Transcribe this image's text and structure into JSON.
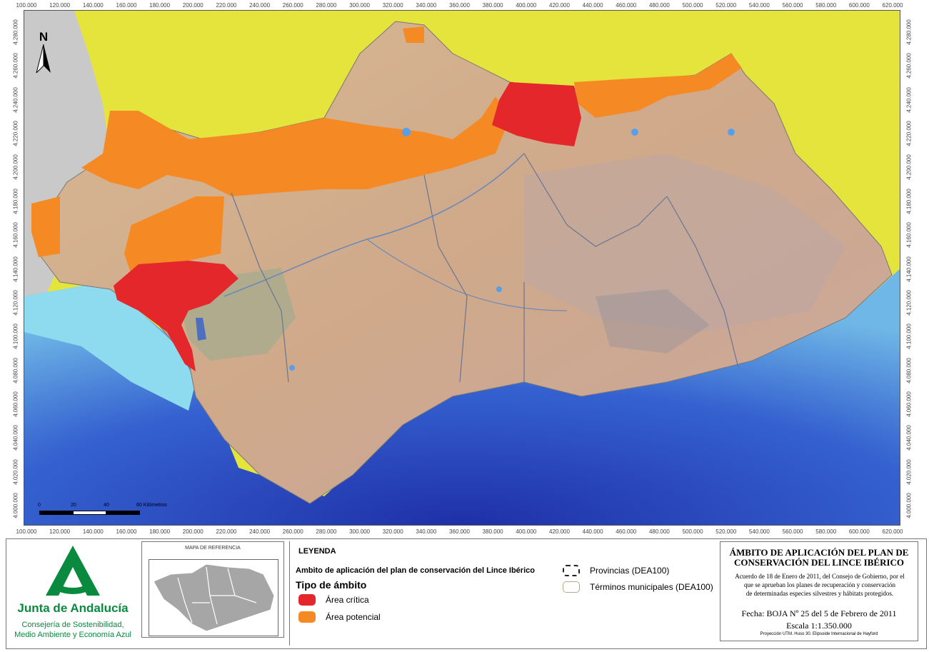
{
  "map": {
    "x_ticks": [
      "100.000",
      "120.000",
      "140.000",
      "160.000",
      "180.000",
      "200.000",
      "220.000",
      "240.000",
      "260.000",
      "280.000",
      "300.000",
      "320.000",
      "340.000",
      "360.000",
      "380.000",
      "400.000",
      "420.000",
      "440.000",
      "460.000",
      "480.000",
      "500.000",
      "520.000",
      "540.000",
      "560.000",
      "580.000",
      "600.000",
      "620.000"
    ],
    "y_ticks": [
      "4.280.000",
      "4.260.000",
      "4.240.000",
      "4.220.000",
      "4.200.000",
      "4.180.000",
      "4.160.000",
      "4.140.000",
      "4.120.000",
      "4.100.000",
      "4.080.000",
      "4.060.000",
      "4.040.000",
      "4.020.000",
      "4.000.000"
    ],
    "north_label": "N",
    "scale_labels": [
      "0",
      "20",
      "40",
      "60 Kilómetros"
    ],
    "colors": {
      "critica": "#e3272b",
      "potencial": "#f58a25",
      "outside": "#e6e63f",
      "portugal": "#c8c8c8",
      "sea_deep": "#2a4fc4",
      "sea_shallow": "#8fdcef",
      "land": "#d9b48e"
    }
  },
  "logo": {
    "name": "Junta de Andalucía",
    "sub1": "Consejería de Sostenibilidad,",
    "sub2": "Medio Ambiente y Economía Azul"
  },
  "reference": {
    "title": "MAPA DE REFERENCIA"
  },
  "legend": {
    "title": "LEYENDA",
    "subtitle": "Ambito de aplicación del plan de conservación del Lince Ibérico",
    "tipo": "Tipo de ámbito",
    "items": [
      {
        "label": "Área crítica",
        "color": "#e3272b"
      },
      {
        "label": "Área potencial",
        "color": "#f58a25"
      }
    ],
    "provincias": "Provincias (DEA100)",
    "terminos": "Términos municipales (DEA100)"
  },
  "title_block": {
    "title_line1": "ÁMBITO DE APLICACIÓN DEL PLAN DE",
    "title_line2": "CONSERVACIÓN DEL LINCE IBÉRICO",
    "body_line1": "Acuerdo de 18 de Enero de 2011, del Consejo de Gobierno, por el",
    "body_line2": "que se aprueban los planes de recuperación y conservación",
    "body_line3": "de determinadas especies silvestres y hábitats protegidos.",
    "fecha": "Fecha: BOJA Nº 25 del 5 de Febrero de 2011",
    "escala": "Escala   1:1.350.000",
    "proyeccion": "Proyección UTM. Huso 30. Elipsoide Internacional de Hayford"
  }
}
